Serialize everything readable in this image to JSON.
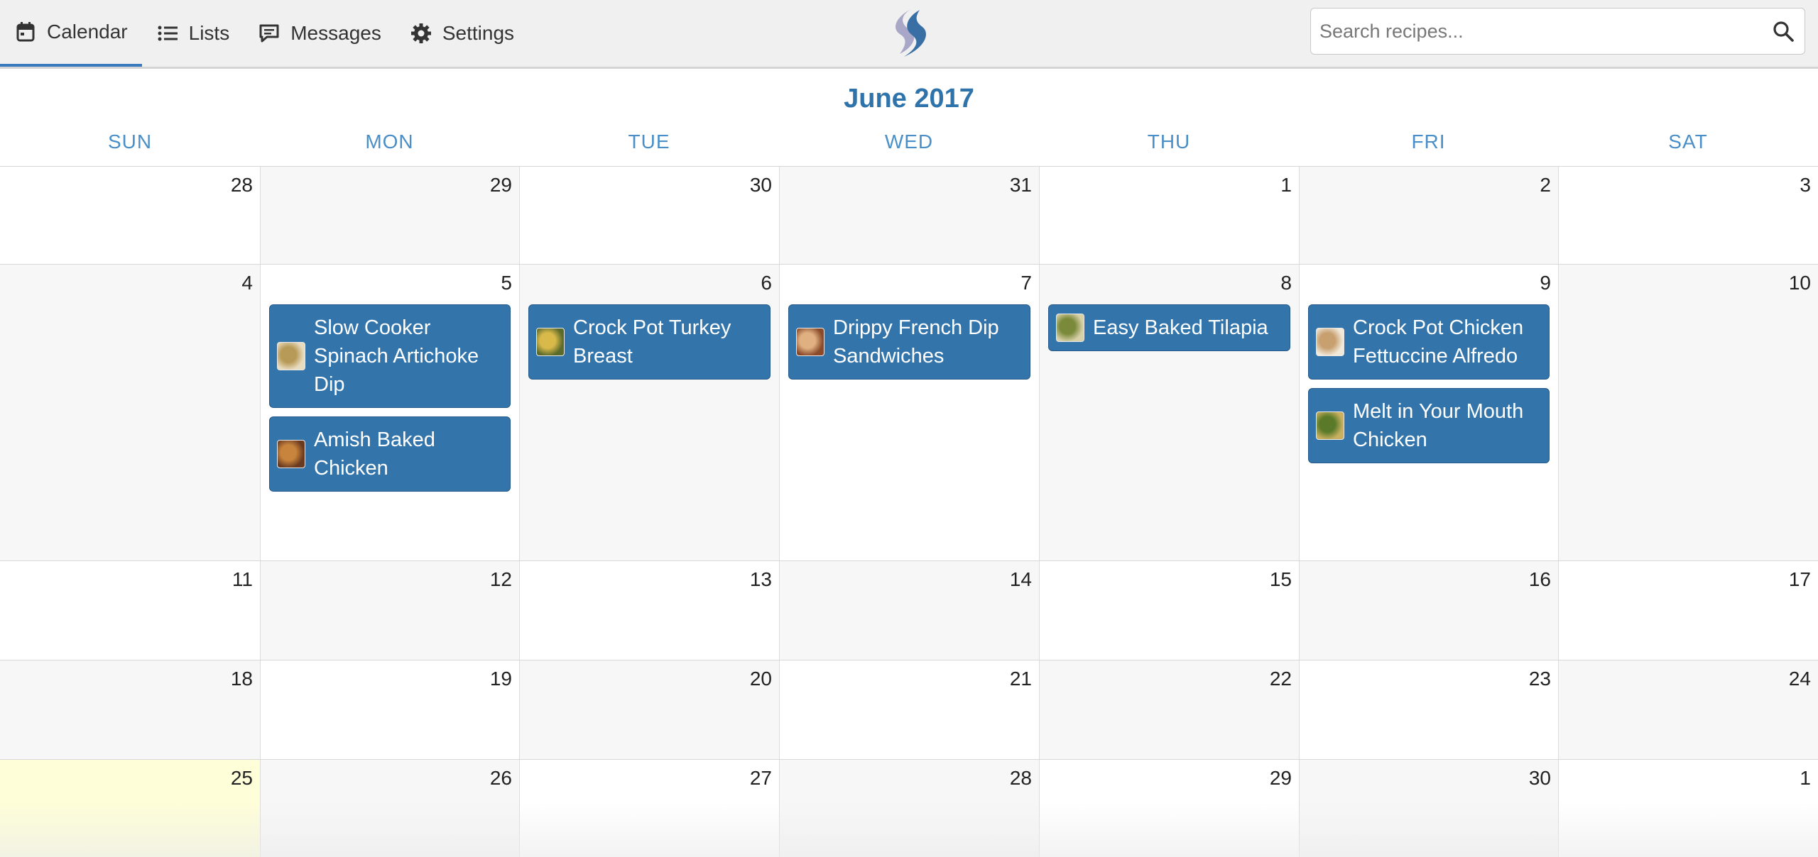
{
  "nav": {
    "calendar": "Calendar",
    "lists": "Lists",
    "messages": "Messages",
    "settings": "Settings"
  },
  "search": {
    "placeholder": "Search recipes..."
  },
  "calendar": {
    "title": "June 2017",
    "weekdays": [
      "SUN",
      "MON",
      "TUE",
      "WED",
      "THU",
      "FRI",
      "SAT"
    ],
    "weeks": [
      {
        "days": [
          {
            "n": "28"
          },
          {
            "n": "29"
          },
          {
            "n": "30"
          },
          {
            "n": "31"
          },
          {
            "n": "1"
          },
          {
            "n": "2"
          },
          {
            "n": "3"
          }
        ]
      },
      {
        "days": [
          {
            "n": "4"
          },
          {
            "n": "5",
            "events": [
              "Slow Cooker Spinach Artichoke Dip",
              "Amish Baked Chicken"
            ]
          },
          {
            "n": "6",
            "events": [
              "Crock Pot Turkey Breast"
            ]
          },
          {
            "n": "7",
            "events": [
              "Drippy French Dip Sandwiches"
            ]
          },
          {
            "n": "8",
            "events": [
              "Easy Baked Tilapia"
            ]
          },
          {
            "n": "9",
            "events": [
              "Crock Pot Chicken Fettuccine Alfredo",
              "Melt in Your Mouth Chicken"
            ]
          },
          {
            "n": "10"
          }
        ]
      },
      {
        "days": [
          {
            "n": "11"
          },
          {
            "n": "12"
          },
          {
            "n": "13"
          },
          {
            "n": "14"
          },
          {
            "n": "15"
          },
          {
            "n": "16"
          },
          {
            "n": "17"
          }
        ]
      },
      {
        "days": [
          {
            "n": "18"
          },
          {
            "n": "19"
          },
          {
            "n": "20"
          },
          {
            "n": "21"
          },
          {
            "n": "22"
          },
          {
            "n": "23"
          },
          {
            "n": "24"
          }
        ]
      },
      {
        "days": [
          {
            "n": "25"
          },
          {
            "n": "26"
          },
          {
            "n": "27"
          },
          {
            "n": "28"
          },
          {
            "n": "29"
          },
          {
            "n": "30"
          },
          {
            "n": "1"
          }
        ]
      }
    ]
  },
  "colors": {
    "accent": "#3375ab",
    "title": "#2f73ab",
    "today": "#fefed8"
  }
}
